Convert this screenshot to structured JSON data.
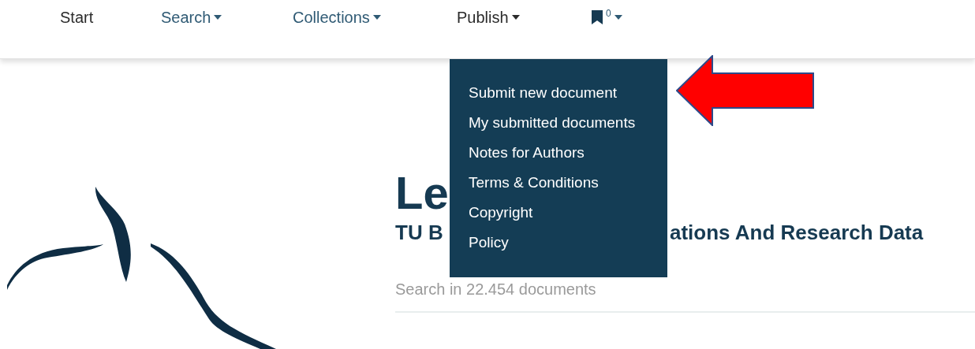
{
  "nav": [
    {
      "kind": "link",
      "label": "Start",
      "dropdown": false
    },
    {
      "kind": "link",
      "label": "Search",
      "dropdown": true,
      "expanded": false
    },
    {
      "kind": "link",
      "label": "Collections",
      "dropdown": true,
      "expanded": false
    },
    {
      "kind": "link",
      "label": "Publish",
      "dropdown": true,
      "expanded": true,
      "menu": [
        "Submit new document",
        "My submitted documents",
        "Notes for Authors",
        "Terms & Conditions",
        "Copyright",
        "Policy"
      ]
    },
    {
      "kind": "bookmarks",
      "count": "0",
      "dropdown": true,
      "expanded": false
    }
  ],
  "heading": "Le",
  "subtitle": [
    "TU B",
    "ations And Research Data"
  ],
  "search_hint": "Search in 22.454 documents"
}
